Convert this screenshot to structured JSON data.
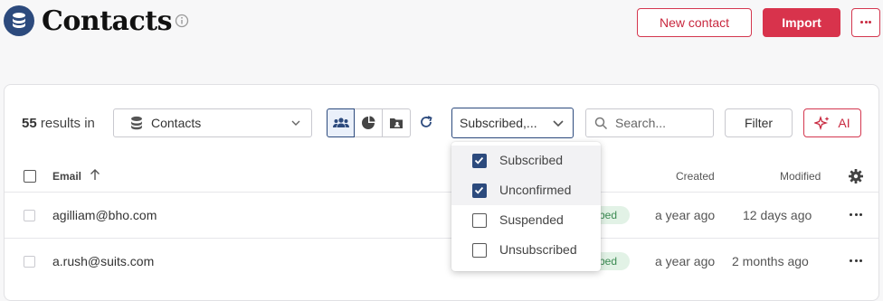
{
  "header": {
    "title": "Contacts",
    "new_contact_label": "New contact",
    "import_label": "Import"
  },
  "toolbar": {
    "results_count": "55",
    "results_suffix": "results in",
    "source_select_value": "Contacts",
    "status_select_value": "Subscribed,...",
    "search_placeholder": "Search...",
    "filter_label": "Filter",
    "ai_label": "AI"
  },
  "table": {
    "columns": {
      "email": "Email",
      "created": "Created",
      "modified": "Modified"
    },
    "rows": [
      {
        "email": "agilliam@bho.com",
        "status_fragment": "bed",
        "created": "a year ago",
        "modified": "12 days ago"
      },
      {
        "email": "a.rush@suits.com",
        "status_fragment": "bed",
        "created": "a year ago",
        "modified": "2 months ago"
      }
    ]
  },
  "status_dropdown": {
    "options": [
      {
        "label": "Subscribed",
        "checked": true
      },
      {
        "label": "Unconfirmed",
        "checked": true
      },
      {
        "label": "Suspended",
        "checked": false
      },
      {
        "label": "Unsubscribed",
        "checked": false
      }
    ]
  },
  "colors": {
    "brand_navy": "#2c4a7d",
    "accent_red": "#d8334c",
    "badge_green_bg": "#e2f2e6",
    "badge_green_text": "#3b8a52"
  },
  "icons": [
    "database-icon",
    "info-icon",
    "more-icon",
    "people-icon",
    "pie-chart-icon",
    "folder-user-icon",
    "refresh-icon",
    "chevron-down-icon",
    "search-icon",
    "sparkle-icon",
    "sort-up-icon",
    "gear-icon",
    "check-icon"
  ]
}
